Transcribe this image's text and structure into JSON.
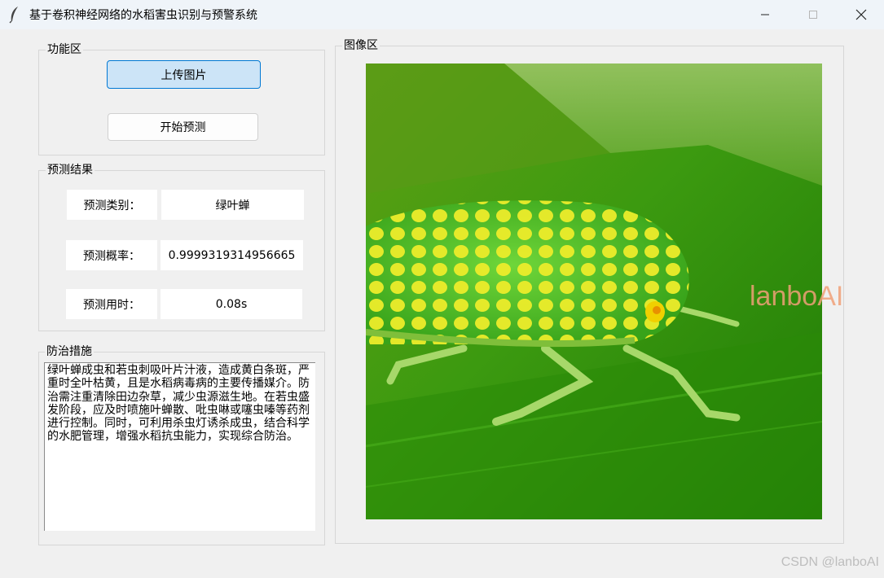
{
  "window": {
    "title": "基于卷积神经网络的水稻害虫识别与预警系统",
    "icon": "feather-icon"
  },
  "function_panel": {
    "label": "功能区",
    "upload_button": "上传图片",
    "predict_button": "开始预测"
  },
  "result_panel": {
    "label": "预测结果",
    "rows": [
      {
        "label": "预测类别：",
        "value": "绿叶蝉"
      },
      {
        "label": "预测概率：",
        "value": "0.9999319314956665"
      },
      {
        "label": "预测用时：",
        "value": "0.08s"
      }
    ]
  },
  "advice_panel": {
    "label": "防治措施",
    "text": "绿叶蝉成虫和若虫刺吸叶片汁液，造成黄白条斑，严重时全叶枯黄，且是水稻病毒病的主要传播媒介。防治需注重清除田边杂草，减少虫源滋生地。在若虫盛发阶段，应及时喷施叶蝉散、吡虫啉或噻虫嗪等药剂进行控制。同时，可利用杀虫灯诱杀成虫，结合科学的水肥管理，增强水稻抗虫能力，实现综合防治。"
  },
  "image_panel": {
    "label": "图像区",
    "image_subject": "green-leafhopper-on-rice-leaf"
  },
  "watermarks": {
    "overlay": "lanboAI",
    "footer": "CSDN @lanboAI"
  }
}
